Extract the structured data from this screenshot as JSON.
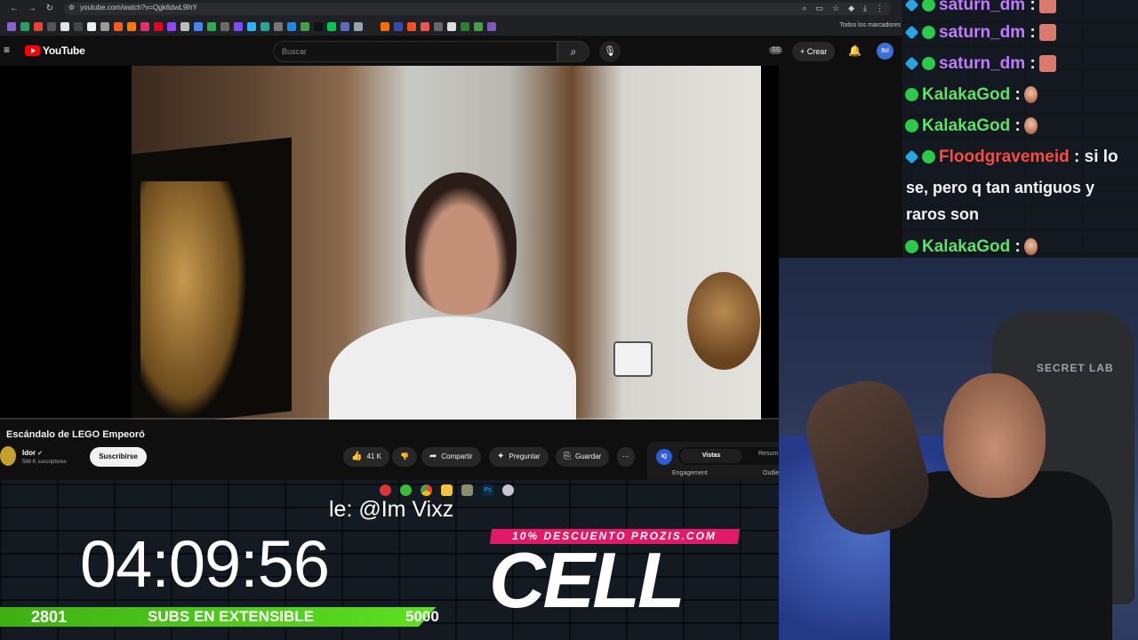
{
  "browser": {
    "url": "youtube.com/watch?v=Qgk6dwL9lhY",
    "bookmarks_folder": "Todos los marcadores"
  },
  "youtube": {
    "logo_text": "YouTube",
    "search_placeholder": "Buscar",
    "ss_badge": "SS",
    "create_label": "Crear",
    "avatar_initials": "Bd",
    "video_title": "Escándalo de LEGO Empeoró",
    "channel_name": "Idor",
    "channel_subs": "568 K suscriptores",
    "subscribe_label": "Suscribirse",
    "likes": "41 K",
    "share_label": "Compartir",
    "ask_label": "Preguntar",
    "save_label": "Guardar",
    "more_label": "···",
    "iq": {
      "logo": "IQ",
      "tab_active": "Vistas",
      "tab_2": "Resum",
      "engagement": "Engagement",
      "outliers": "Outlie"
    }
  },
  "overlay": {
    "credit": "le: @Im Vixz",
    "timer": "04:09:56",
    "subs_current": "2801",
    "subs_label": "SUBS EN EXTENSIBLE",
    "subs_goal": "5000",
    "subs_progress": 0.56,
    "promo": "10% DESCUENTO PROZIS.COM",
    "brand": "CELL"
  },
  "chat": {
    "lines": [
      {
        "user": "saturn_dm",
        "color": "#c07bff",
        "badges": [
          "cube",
          "green"
        ],
        "sep": " :",
        "emote": "pixel"
      },
      {
        "user": "saturn_dm",
        "color": "#c07bff",
        "badges": [
          "cube",
          "green"
        ],
        "sep": " :",
        "emote": "pixel"
      },
      {
        "user": "saturn_dm",
        "color": "#c07bff",
        "badges": [
          "cube",
          "green"
        ],
        "sep": " :",
        "emote": "pixel"
      },
      {
        "user": "KalakaGod",
        "color": "#5ee06a",
        "badges": [
          "green"
        ],
        "sep": " :",
        "emote": "face"
      },
      {
        "user": "KalakaGod",
        "color": "#5ee06a",
        "badges": [
          "green"
        ],
        "sep": " :",
        "emote": "face"
      },
      {
        "user": "Floodgravemeid",
        "color": "#ff4a3d",
        "badges": [
          "cube",
          "green"
        ],
        "sep": " : si lo",
        "emote": ""
      },
      {
        "user": "KalakaGod",
        "color": "#5ee06a",
        "badges": [
          "green"
        ],
        "sep": " :",
        "emote": "face"
      }
    ],
    "continuation_1": "se, pero q tan antiguos y",
    "continuation_2": "raros son"
  },
  "webcam": {
    "chair_brand": "SECRET LAB"
  }
}
